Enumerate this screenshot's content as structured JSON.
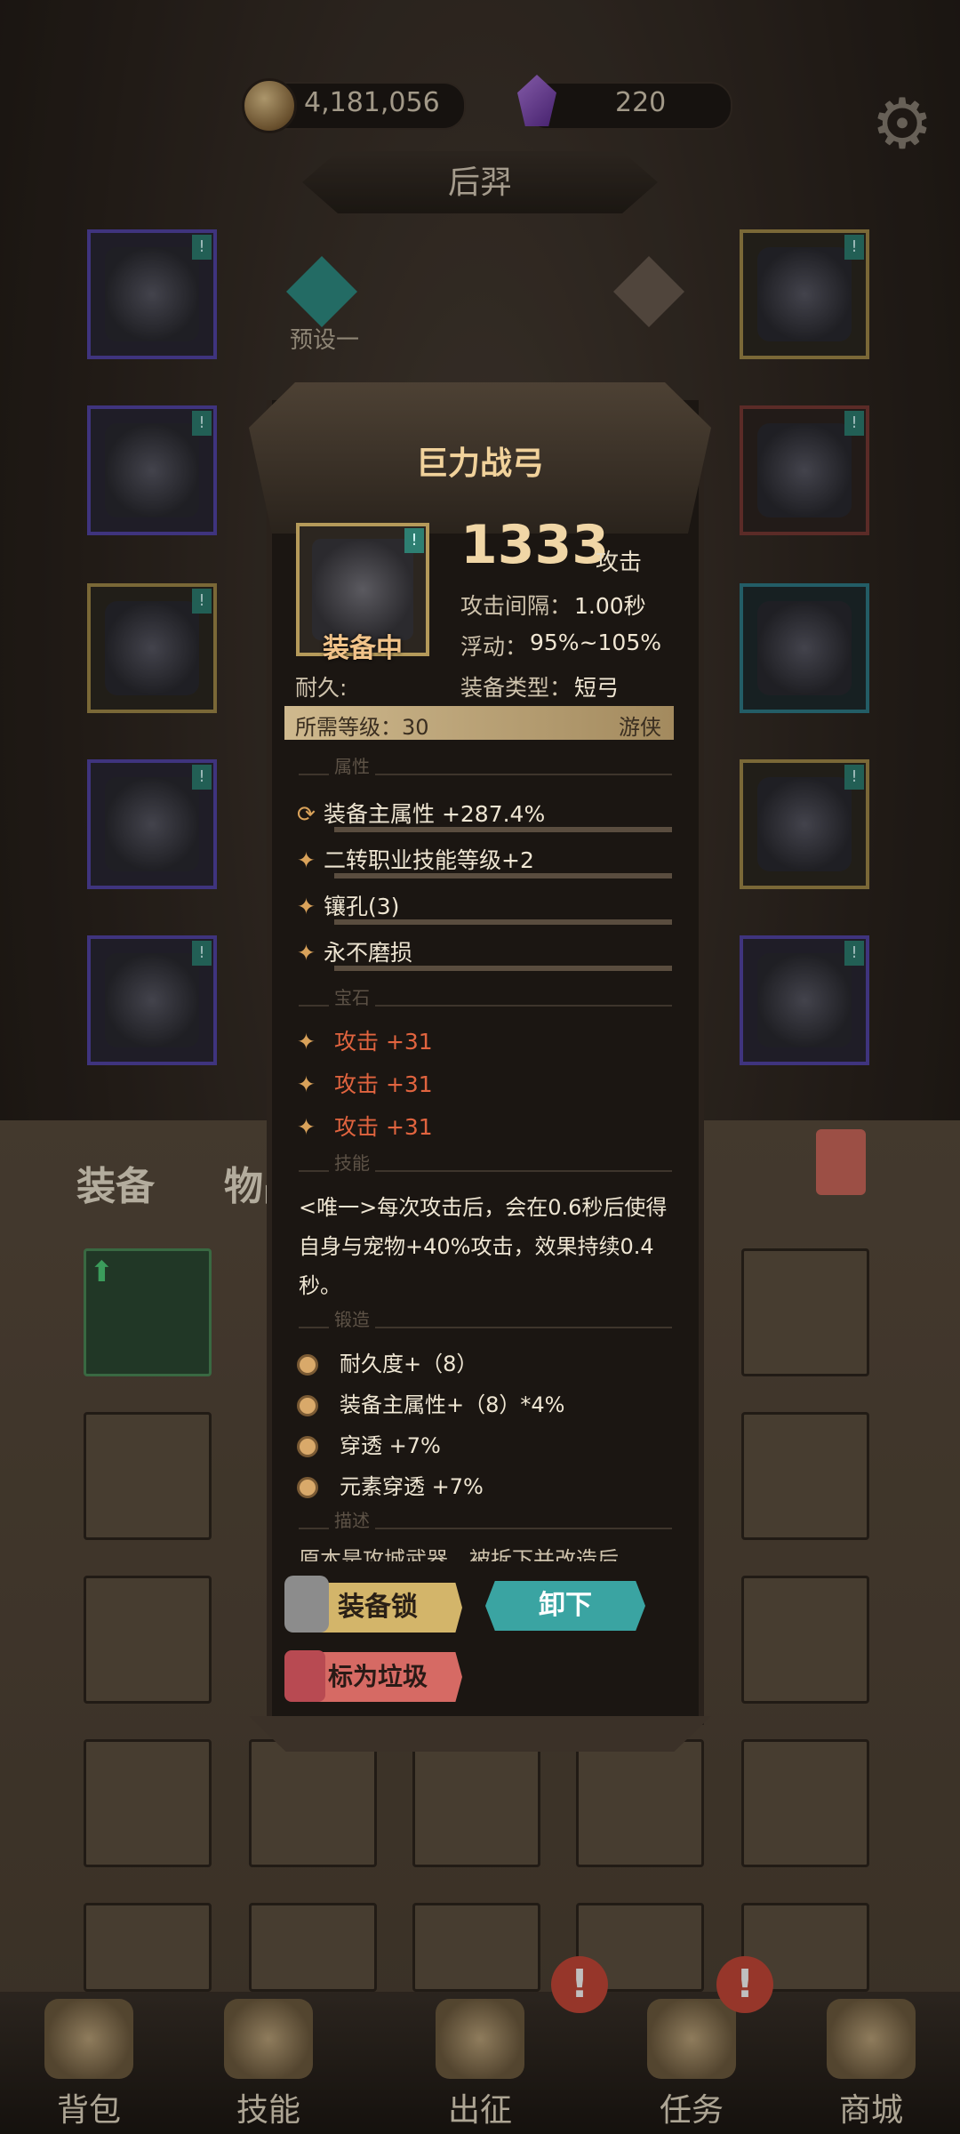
{
  "resources": {
    "gold": "4,181,056",
    "gems": "220"
  },
  "hero": {
    "name": "后羿",
    "preset_label": "预设一"
  },
  "item": {
    "name": "巨力战弓",
    "status": "装备中",
    "attack_value": "1333",
    "attack_label": "攻击",
    "interval_label": "攻击间隔：",
    "interval_value": "1.00秒",
    "float_label": "浮动：",
    "float_value": "95%~105%",
    "durability_label": "耐久:",
    "type_label": "装备类型：",
    "type_value": "短弓",
    "required_level": "所需等级：30",
    "class": "游侠",
    "sections": {
      "attributes": "属性",
      "gems": "宝石",
      "skill": "技能",
      "forge": "锻造",
      "description": "描述"
    },
    "attributes": [
      {
        "icon": "refresh-icon",
        "text": "装备主属性 +287.4%"
      },
      {
        "icon": "sparkle-icon",
        "text": "二转职业技能等级+2"
      },
      {
        "icon": "sparkle-icon",
        "text": "镶孔(3)"
      },
      {
        "icon": "sparkle-icon",
        "text": "永不磨损"
      }
    ],
    "gems": [
      "攻击 +31",
      "攻击 +31",
      "攻击 +31"
    ],
    "skill_text": "<唯一>每次攻击后，会在0.6秒后使得自身与宠物+40%攻击，效果持续0.4秒。",
    "forge": [
      "耐久度+（8）",
      "装备主属性+（8）*4%",
      "穿透 +7%",
      "元素穿透 +7%"
    ],
    "description": "原本是攻城武器，被拆下并改造后"
  },
  "buttons": {
    "lock": "装备锁",
    "unequip": "卸下",
    "mark_trash": "标为垃圾"
  },
  "inventory_tabs": {
    "equipment": "装备",
    "items": "物品"
  },
  "nav": [
    {
      "label": "背包",
      "icon": "backpack-icon"
    },
    {
      "label": "技能",
      "icon": "skill-book-icon"
    },
    {
      "label": "出征",
      "icon": "sword-icon"
    },
    {
      "label": "任务",
      "icon": "quest-scroll-icon"
    },
    {
      "label": "商城",
      "icon": "shop-icon"
    }
  ],
  "badges": [
    "!",
    "!"
  ]
}
